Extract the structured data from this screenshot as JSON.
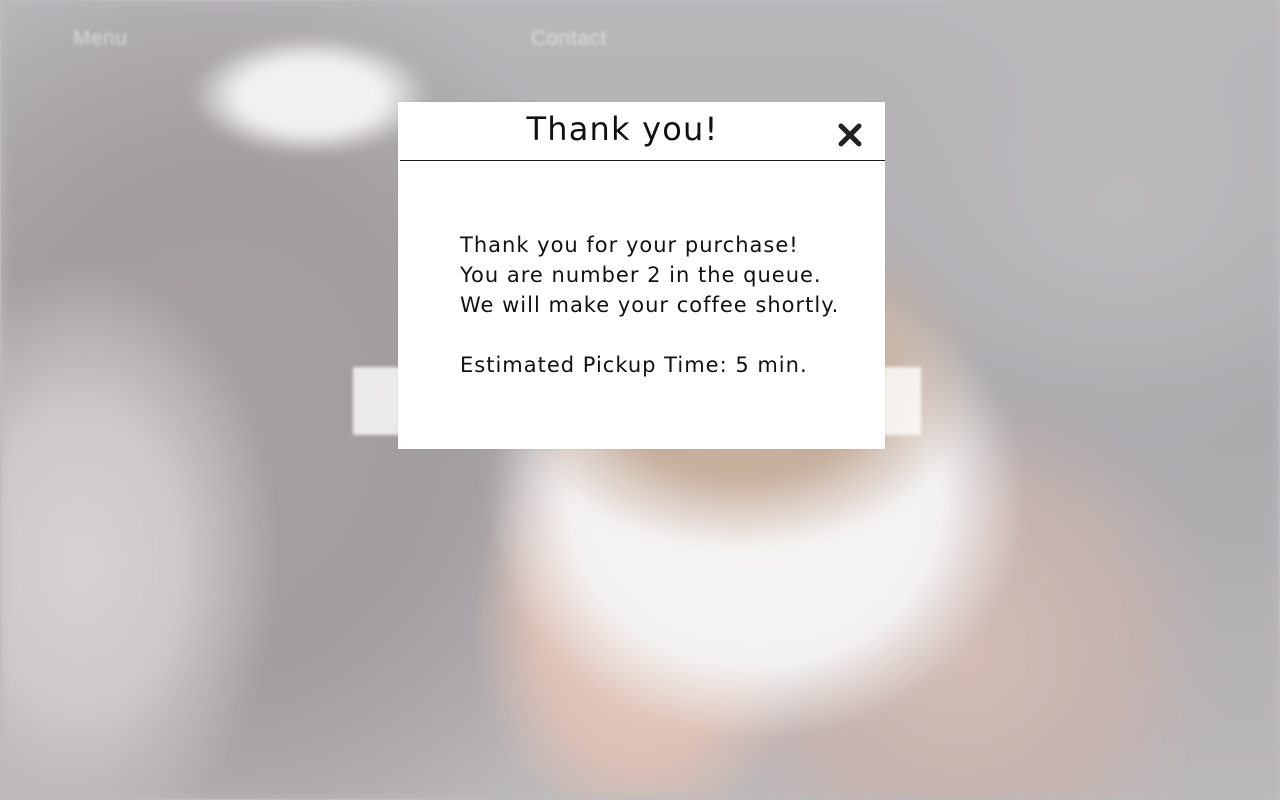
{
  "nav": {
    "menu_label": "Menu",
    "contact_label": "Contact"
  },
  "modal": {
    "title": "Thank you!",
    "close_icon": "close-icon",
    "message_lines": [
      "Thank you for your purchase!",
      "You are number 2 in the queue.",
      "We will make your coffee shortly."
    ],
    "pickup_time": "Estimated Pickup Time: 5 min."
  },
  "colors": {
    "modal_background": "#ffffff",
    "text": "#111111",
    "close_icon": "#222222"
  }
}
